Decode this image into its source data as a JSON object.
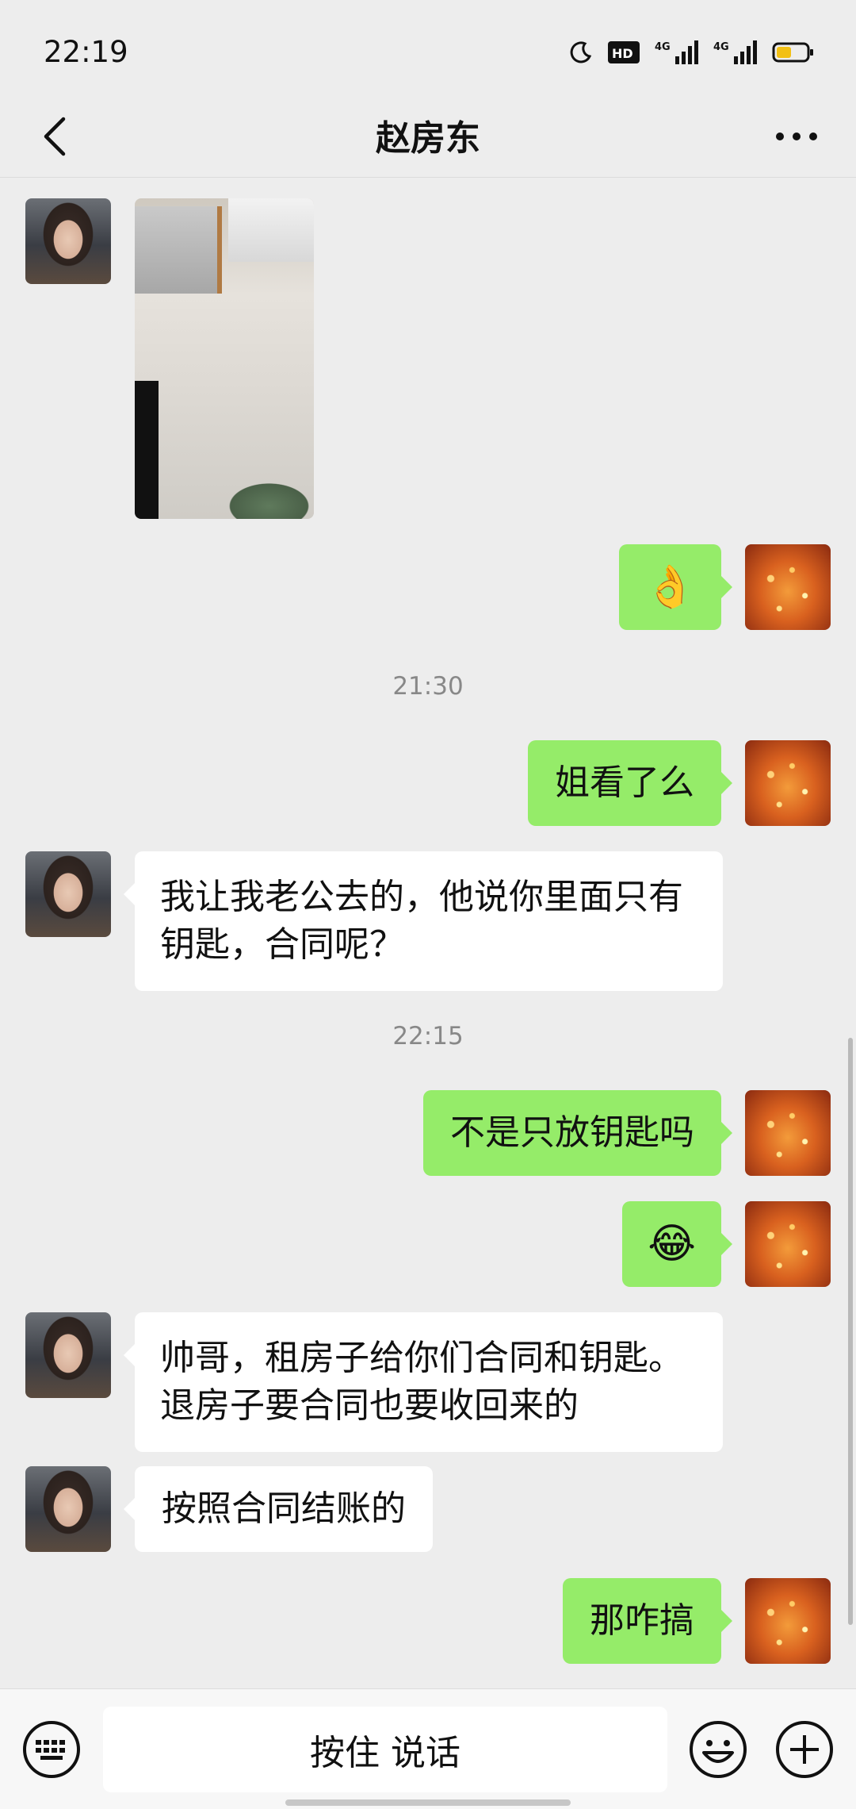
{
  "status_bar": {
    "time": "22:19",
    "icons": [
      "moon-icon",
      "hd-icon",
      "signal-icon",
      "signal-4g-icon",
      "battery-icon"
    ]
  },
  "header": {
    "title": "赵房东",
    "back_icon": "chevron-left-icon",
    "more_icon": "more-dots-icon"
  },
  "messages": {
    "m1": {
      "type": "image",
      "sender": "contact"
    },
    "m2": {
      "type": "emoji",
      "sender": "me",
      "text": "👌"
    },
    "t1": "21:30",
    "m3": {
      "sender": "me",
      "text": "姐看了么"
    },
    "m4": {
      "sender": "contact",
      "text": "我让我老公去的，他说你里面只有\n钥匙，合同呢？"
    },
    "t2": "22:15",
    "m5": {
      "sender": "me",
      "text": "不是只放钥匙吗"
    },
    "m6": {
      "type": "emoji",
      "sender": "me",
      "text": "😂"
    },
    "m7": {
      "sender": "contact",
      "text": "帅哥，租房子给你们合同和钥匙。\n退房子要合同也要收回来的"
    },
    "m8": {
      "sender": "contact",
      "text": "按照合同结账的"
    },
    "m9": {
      "sender": "me",
      "text": "那咋搞"
    }
  },
  "input_bar": {
    "voice_label": "按住 说话",
    "keyboard_icon": "keyboard-icon",
    "emoji_icon": "smiley-icon",
    "add_icon": "plus-circle-icon"
  },
  "colors": {
    "outgoing_bubble": "#95ec69",
    "incoming_bubble": "#ffffff",
    "background": "#ededed"
  }
}
